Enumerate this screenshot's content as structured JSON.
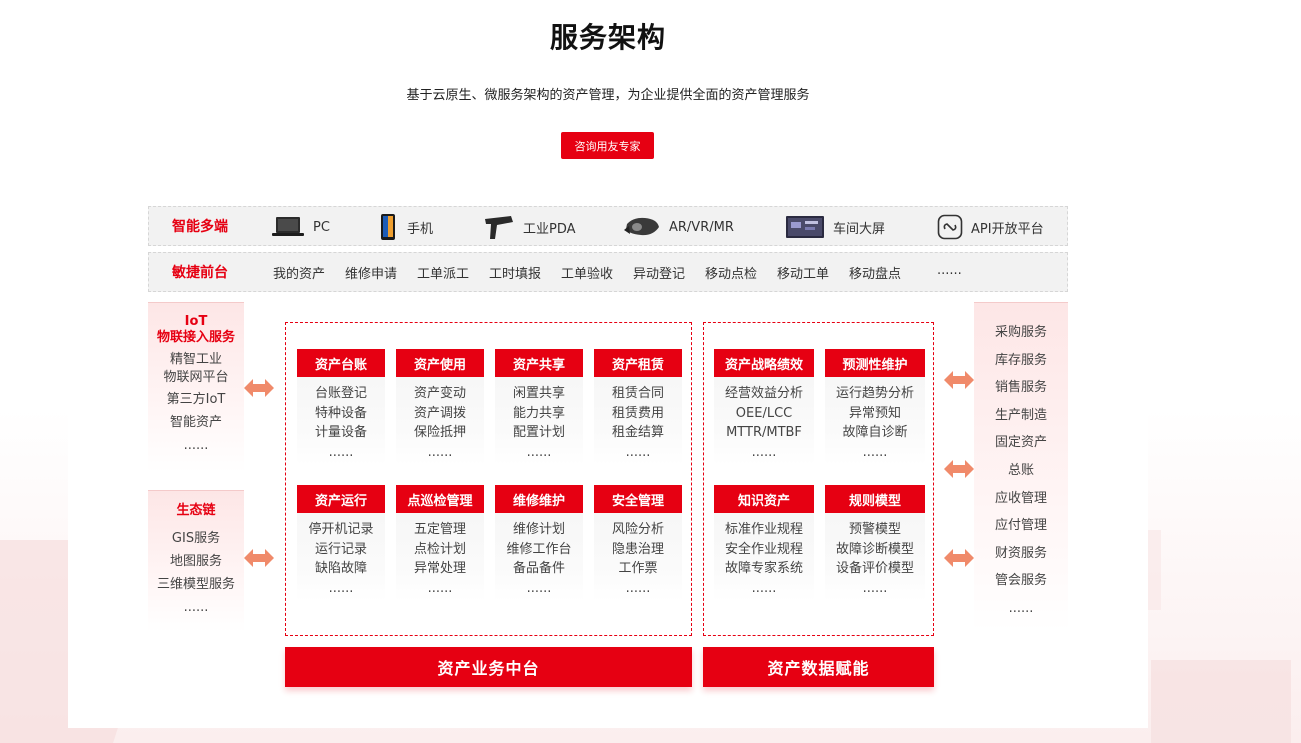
{
  "header": {
    "title": "服务架构",
    "subtitle": "基于云原生、微服务架构的资产管理，为企业提供全面的资产管理服务",
    "cta_label": "咨询用友专家"
  },
  "terminals": {
    "label": "智能多端",
    "items": [
      {
        "label": "PC",
        "icon": "laptop-icon"
      },
      {
        "label": "手机",
        "icon": "smartphone-icon"
      },
      {
        "label": "工业PDA",
        "icon": "pda-scanner-icon"
      },
      {
        "label": "AR/VR/MR",
        "icon": "vr-headset-icon"
      },
      {
        "label": "车间大屏",
        "icon": "large-screen-icon"
      },
      {
        "label": "API开放平台",
        "icon": "api-link-icon"
      }
    ]
  },
  "frontend": {
    "label": "敏捷前台",
    "items": [
      "我的资产",
      "维修申请",
      "工单派工",
      "工时填报",
      "工单验收",
      "异动登记",
      "移动点检",
      "移动工单",
      "移动盘点",
      "......"
    ]
  },
  "left_panels": [
    {
      "title_lines": [
        "IoT",
        "物联接入服务"
      ],
      "items": [
        "精智工业",
        "物联网平台",
        "第三方IoT",
        "智能资产",
        "......"
      ]
    },
    {
      "title_lines": [
        "生态链"
      ],
      "items": [
        "GIS服务",
        "地图服务",
        "三维模型服务",
        "......"
      ]
    }
  ],
  "right_panel": {
    "items": [
      "采购服务",
      "库存服务",
      "销售服务",
      "生产制造",
      "固定资产",
      "总账",
      "应收管理",
      "应付管理",
      "财资服务",
      "管会服务",
      "......"
    ]
  },
  "business_modules": [
    {
      "title": "资产台账",
      "items": [
        "台账登记",
        "特种设备",
        "计量设备",
        "......"
      ]
    },
    {
      "title": "资产使用",
      "items": [
        "资产变动",
        "资产调拨",
        "保险抵押",
        "......"
      ]
    },
    {
      "title": "资产共享",
      "items": [
        "闲置共享",
        "能力共享",
        "配置计划",
        "......"
      ]
    },
    {
      "title": "资产租赁",
      "items": [
        "租赁合同",
        "租赁费用",
        "租金结算",
        "......"
      ]
    },
    {
      "title": "资产运行",
      "items": [
        "停开机记录",
        "运行记录",
        "缺陷故障",
        "......"
      ]
    },
    {
      "title": "点巡检管理",
      "items": [
        "五定管理",
        "点检计划",
        "异常处理",
        "......"
      ]
    },
    {
      "title": "维修维护",
      "items": [
        "维修计划",
        "维修工作台",
        "备品备件",
        "......"
      ]
    },
    {
      "title": "安全管理",
      "items": [
        "风险分析",
        "隐患治理",
        "工作票",
        "......"
      ]
    }
  ],
  "data_modules": [
    {
      "title": "资产战略绩效",
      "items": [
        "经营效益分析",
        "OEE/LCC",
        "MTTR/MTBF",
        "......"
      ]
    },
    {
      "title": "预测性维护",
      "items": [
        "运行趋势分析",
        "异常预知",
        "故障自诊断",
        "......"
      ]
    },
    {
      "title": "知识资产",
      "items": [
        "标准作业规程",
        "安全作业规程",
        "故障专家系统",
        "......"
      ]
    },
    {
      "title": "规则模型",
      "items": [
        "预警模型",
        "故障诊断模型",
        "设备评价模型",
        "......"
      ]
    }
  ],
  "bottom_bars": {
    "business": "资产业务中台",
    "data": "资产数据赋能"
  },
  "colors": {
    "accent": "#e60012",
    "band_bg": "#f2f2f2",
    "panel_bg": "#fde6e6"
  }
}
